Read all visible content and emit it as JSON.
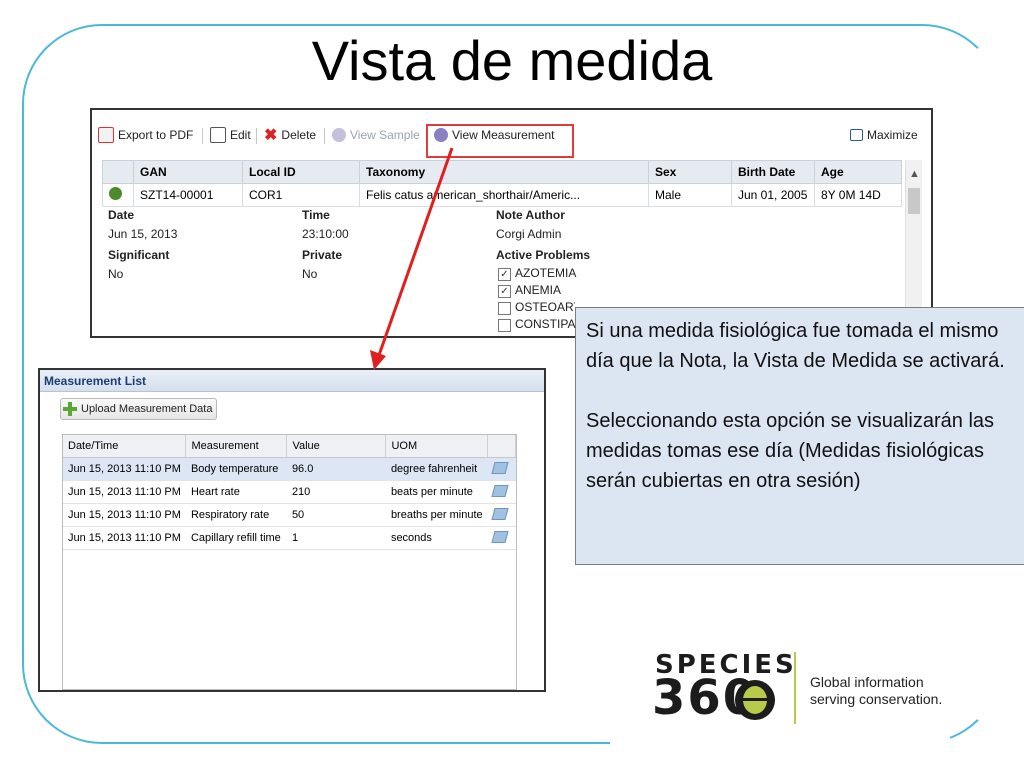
{
  "slide": {
    "title": "Vista de medida"
  },
  "record_window": {
    "toolbar": {
      "export_label": "Export to PDF",
      "edit_label": "Edit",
      "delete_label": "Delete",
      "view_sample_label": "View Sample",
      "view_measurement_label": "View Measurement",
      "maximize_label": "Maximize"
    },
    "grid": {
      "columns": [
        "GAN",
        "Local ID",
        "Taxonomy",
        "Sex",
        "Birth Date",
        "Age"
      ],
      "row": [
        "SZT14-00001",
        "COR1",
        "Felis catus american_shorthair/Americ...",
        "Male",
        "Jun 01, 2005",
        "8Y 0M 14D"
      ]
    },
    "note": {
      "date_label": "Date",
      "date_value": "Jun 15, 2013",
      "time_label": "Time",
      "time_value": "23:10:00",
      "author_label": "Note Author",
      "author_value": "Corgi Admin",
      "significant_label": "Significant",
      "significant_value": "No",
      "private_label": "Private",
      "private_value": "No",
      "problems_label": "Active Problems",
      "problems": [
        {
          "label": "AZOTEMIA",
          "checked": true
        },
        {
          "label": "ANEMIA",
          "checked": true
        },
        {
          "label": "OSTEOARTHRITIS, COXOFEMORAL JOINT (NOS), MILD",
          "checked": false
        },
        {
          "label": "CONSTIPAT",
          "checked": false
        }
      ]
    }
  },
  "measurement_list": {
    "title": "Measurement List",
    "upload_label": "Upload Measurement Data",
    "columns": [
      "Date/Time",
      "Measurement",
      "Value",
      "UOM"
    ],
    "rows": [
      [
        "Jun 15, 2013 11:10 PM",
        "Body temperature",
        "96.0",
        "degree fahrenheit"
      ],
      [
        "Jun 15, 2013 11:10 PM",
        "Heart rate",
        "210",
        "beats per minute"
      ],
      [
        "Jun 15, 2013 11:10 PM",
        "Respiratory rate",
        "50",
        "breaths per minute"
      ],
      [
        "Jun 15, 2013 11:10 PM",
        "Capillary refill time",
        "1",
        "seconds"
      ]
    ]
  },
  "callout": {
    "paragraph1": "Si una medida fisiológica fue tomada el mismo día que la Nota, la Vista de Medida se activará.",
    "paragraph2": "Seleccionando esta opción se visualizarán las medidas tomas ese día (Medidas fisiológicas serán cubiertas en otra sesión)"
  },
  "logo": {
    "word_top": "SPECIES",
    "word_bottom": "360",
    "tagline_line1": "Global information",
    "tagline_line2": "serving conservation."
  },
  "colors": {
    "frame": "#4cb8d9",
    "highlight": "#e23b3b",
    "callout_bg": "#dce6f2",
    "logo_accent": "#b9c94a"
  }
}
